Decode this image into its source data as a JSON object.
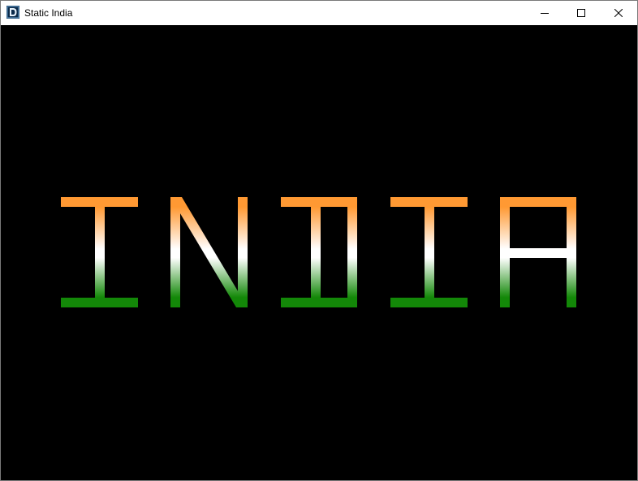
{
  "window": {
    "title": "Static India",
    "app_icon": "app-d-logo-icon",
    "controls": {
      "minimize_icon": "minimize-icon",
      "maximize_icon": "maximize-icon",
      "close_icon": "close-icon"
    }
  },
  "canvas": {
    "background": "#000000",
    "word": [
      "I",
      "N",
      "D",
      "I",
      "A"
    ],
    "colors": {
      "saffron": "#FF9933",
      "white": "#FFFFFF",
      "green": "#138808"
    }
  }
}
